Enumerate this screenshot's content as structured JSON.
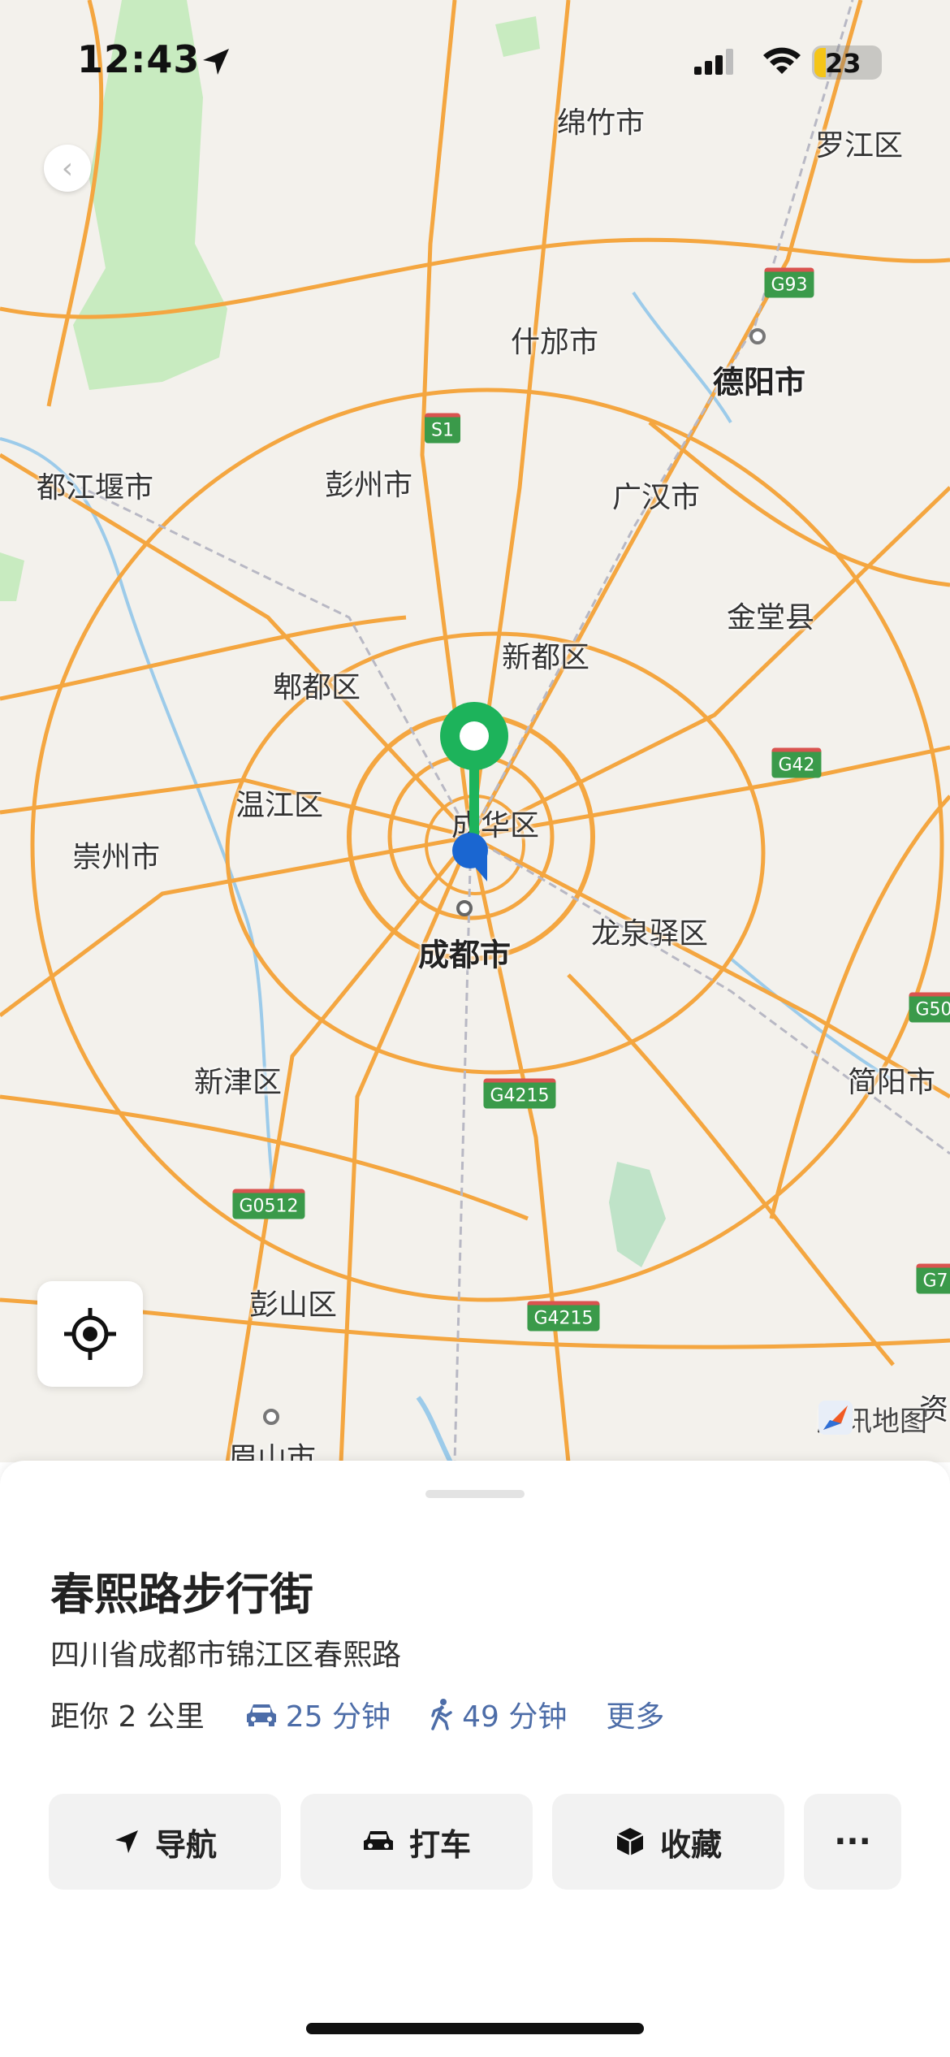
{
  "status_bar": {
    "time": "12:43",
    "battery": "23"
  },
  "map": {
    "labels": [
      {
        "text": "绵竹市",
        "big": false
      },
      {
        "text": "罗江区",
        "big": false
      },
      {
        "text": "什邡市",
        "big": false
      },
      {
        "text": "德阳市",
        "big": true
      },
      {
        "text": "都江堰市",
        "big": false
      },
      {
        "text": "彭州市",
        "big": false
      },
      {
        "text": "广汉市",
        "big": false
      },
      {
        "text": "金堂县",
        "big": false
      },
      {
        "text": "新都区",
        "big": false
      },
      {
        "text": "郫都区",
        "big": false
      },
      {
        "text": "温江区",
        "big": false
      },
      {
        "text": "成华区",
        "big": false
      },
      {
        "text": "崇州市",
        "big": false
      },
      {
        "text": "龙泉驿区",
        "big": false
      },
      {
        "text": "成都市",
        "big": true
      },
      {
        "text": "新津区",
        "big": false
      },
      {
        "text": "简阳市",
        "big": false
      },
      {
        "text": "彭山区",
        "big": false
      },
      {
        "text": "眉山市",
        "big": false
      },
      {
        "text": "资",
        "big": false
      }
    ],
    "shields": [
      "G93",
      "S1",
      "G42",
      "G4215",
      "G0512",
      "G4215",
      "G50",
      "G7"
    ],
    "watermark": "腾讯地图"
  },
  "place": {
    "title": "春熙路步行街",
    "address": "四川省成都市锦江区春熙路",
    "distance": "距你 2 公里",
    "drive_time": "25 分钟",
    "walk_time": "49 分钟",
    "more_link": "更多"
  },
  "actions": {
    "navigate": "导航",
    "taxi": "打车",
    "favorite": "收藏",
    "more": "···"
  },
  "colors": {
    "accent_link": "#4d6da8",
    "pin_green": "#1db35b",
    "location_blue": "#1a66d1",
    "road_orange": "#f4a640"
  }
}
